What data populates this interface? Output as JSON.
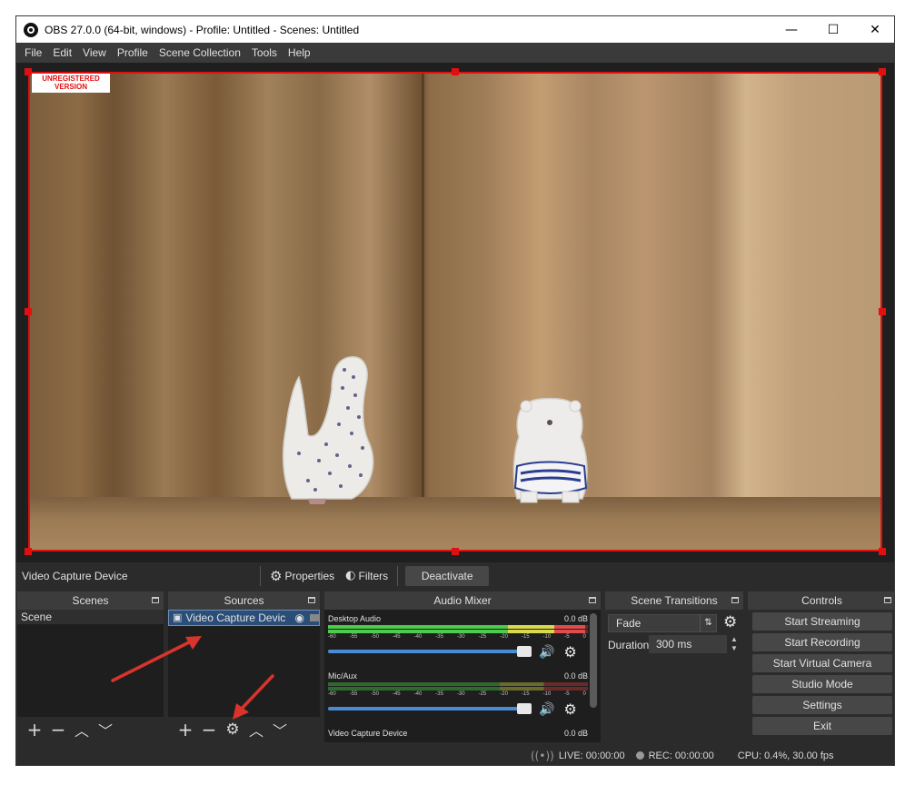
{
  "window": {
    "title": "OBS 27.0.0 (64-bit, windows) - Profile: Untitled - Scenes: Untitled",
    "minimize": "—",
    "maximize": "☐",
    "close": "✕"
  },
  "menu": [
    "File",
    "Edit",
    "View",
    "Profile",
    "Scene Collection",
    "Tools",
    "Help"
  ],
  "preview": {
    "watermark_line1": "UNREGISTERED",
    "watermark_line2": "VERSION"
  },
  "context_bar": {
    "source_name": "Video Capture Device",
    "properties_label": "Properties",
    "filters_label": "Filters",
    "deactivate_label": "Deactivate"
  },
  "docks": {
    "scenes": {
      "title": "Scenes",
      "items": [
        "Scene"
      ]
    },
    "sources": {
      "title": "Sources",
      "items": [
        "Video Capture Devic"
      ]
    },
    "mixer": {
      "title": "Audio Mixer",
      "channels": [
        {
          "name": "Desktop Audio",
          "db": "0.0 dB",
          "level": 0.99,
          "volume": 1.0
        },
        {
          "name": "Mic/Aux",
          "db": "0.0 dB",
          "level": 0.0,
          "volume": 1.0
        },
        {
          "name": "Video Capture Device",
          "db": "0.0 dB"
        }
      ],
      "ticks": [
        "-60",
        "-55",
        "-50",
        "-45",
        "-40",
        "-35",
        "-30",
        "-25",
        "-20",
        "-15",
        "-10",
        "-5",
        "0"
      ]
    },
    "transitions": {
      "title": "Scene Transitions",
      "selected": "Fade",
      "duration_label": "Duration",
      "duration_value": "300 ms"
    },
    "controls": {
      "title": "Controls",
      "buttons": [
        "Start Streaming",
        "Start Recording",
        "Start Virtual Camera",
        "Studio Mode",
        "Settings",
        "Exit"
      ]
    }
  },
  "status": {
    "live": "LIVE: 00:00:00",
    "rec": "REC: 00:00:00",
    "cpu": "CPU: 0.4%, 30.00 fps"
  },
  "colors": {
    "selection": "#e01010",
    "panel": "#2b2b2b",
    "annotation_arrow": "#d9342b"
  }
}
